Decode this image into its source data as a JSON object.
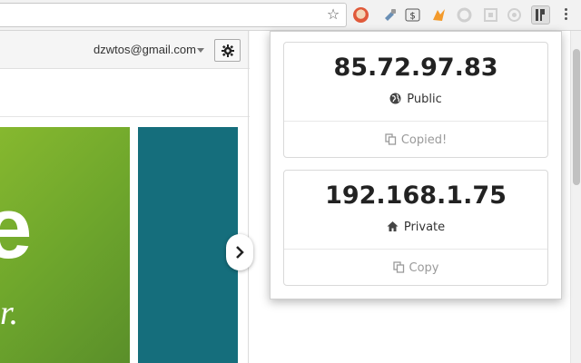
{
  "toolbar": {
    "bookmark_icon": "star-icon",
    "extensions": [
      "chrome-mascot-icon",
      "puzzle-icon",
      "dollar-icon",
      "fox-icon",
      "flame-icon",
      "grid-icon",
      "circle-icon",
      "ip-tool-icon"
    ]
  },
  "page": {
    "account_email": "dzwtos@gmail.com"
  },
  "popup": {
    "public": {
      "ip": "85.72.97.83",
      "label": "Public",
      "copy_label": "Copied!"
    },
    "private": {
      "ip": "192.168.1.75",
      "label": "Private",
      "copy_label": "Copy"
    }
  },
  "colors": {
    "green_tile": "#7ab32e",
    "teal_tile": "#156e7c",
    "muted_text": "#9a9a9a"
  }
}
